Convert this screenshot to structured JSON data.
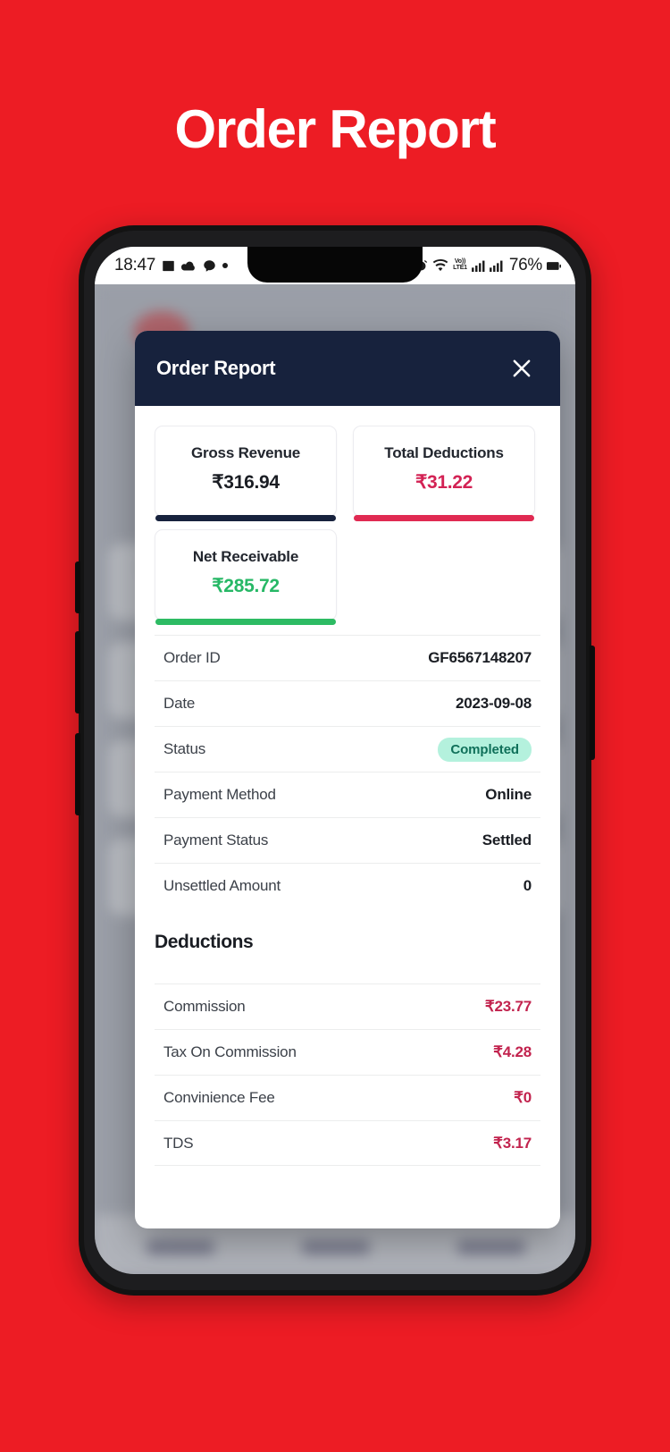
{
  "poster": {
    "title": "Order Report"
  },
  "status_bar": {
    "time": "18:47",
    "left_icons": [
      "image-icon",
      "cloud-icon",
      "chat-bubble-icon",
      "dot-icon"
    ],
    "alarm": "alarm-icon",
    "wifi": "wifi-icon",
    "network_type": "VoLTE1",
    "volte_top": "Vo))",
    "volte_bottom": "LTE1",
    "signal_1": "signal-bars-icon",
    "signal_2": "signal-bars-icon",
    "battery_percent": "76%",
    "battery": "battery-icon"
  },
  "modal": {
    "title": "Order Report",
    "close_icon": "close-icon",
    "summary_cards": [
      {
        "label": "Gross Revenue",
        "value": "₹316.94",
        "value_color": "#1a1d23",
        "accent_color": "#17223d"
      },
      {
        "label": "Total Deductions",
        "value": "₹31.22",
        "value_color": "#d32254",
        "accent_color": "#e02a52"
      },
      {
        "label": "Net Receivable",
        "value": "₹285.72",
        "value_color": "#27b866",
        "accent_color": "#2dbb63"
      }
    ],
    "details": [
      {
        "key": "Order ID",
        "value": "GF6567148207",
        "type": "text"
      },
      {
        "key": "Date",
        "value": "2023-09-08",
        "type": "text"
      },
      {
        "key": "Status",
        "value": "Completed",
        "type": "badge"
      },
      {
        "key": "Payment Method",
        "value": "Online",
        "type": "text"
      },
      {
        "key": "Payment Status",
        "value": "Settled",
        "type": "text"
      },
      {
        "key": "Unsettled Amount",
        "value": "0",
        "type": "text"
      }
    ],
    "deductions_title": "Deductions",
    "deductions": [
      {
        "key": "Commission",
        "value": "₹23.77"
      },
      {
        "key": "Tax On Commission",
        "value": "₹4.28"
      },
      {
        "key": "Convinience Fee",
        "value": "₹0"
      },
      {
        "key": "TDS",
        "value": "₹3.17"
      }
    ]
  },
  "colors": {
    "poster_background": "#ed1c24",
    "modal_header": "#17223d",
    "accent_red": "#e02a52",
    "accent_green": "#2dbb63",
    "badge_bg": "#b4f1dd",
    "badge_text": "#10705a"
  }
}
